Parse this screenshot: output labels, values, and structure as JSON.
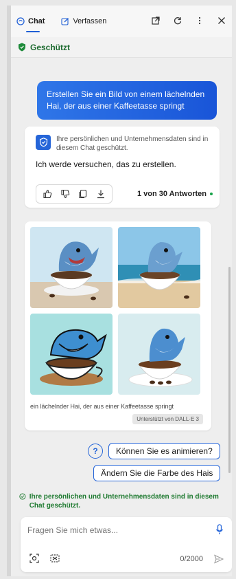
{
  "header": {
    "tabs": [
      {
        "label": "Chat",
        "active": true
      },
      {
        "label": "Verfassen",
        "active": false
      }
    ],
    "actions": [
      "open-external-icon",
      "refresh-icon",
      "more-icon",
      "close-icon"
    ]
  },
  "protected_banner": {
    "label": "Geschützt"
  },
  "conversation": {
    "user_message": "Erstellen Sie ein Bild von einem lächelnden Hai, der aus einer Kaffeetasse springt",
    "bot": {
      "notice": "Ihre persönlichen und Unternehmensdaten sind in diesem Chat geschützt.",
      "reply": "Ich werde versuchen, das zu erstellen.",
      "answer_count": "1 von 30 Antworten"
    },
    "image_result": {
      "caption": "ein lächelnder Hai, der aus einer Kaffeetasse springt",
      "badge": "Unterstützt von DALL·E 3"
    }
  },
  "suggestions": [
    {
      "label": "Können Sie es animieren?"
    },
    {
      "label": "Ändern Sie die Farbe des Hais"
    }
  ],
  "privacy_footer": "Ihre persönlichen und Unternehmensdaten sind in diesem Chat geschützt.",
  "composer": {
    "placeholder": "Fragen Sie mich etwas...",
    "counter": "0/2000"
  },
  "colors": {
    "accent": "#2565d8",
    "protected_green": "#1e7a30",
    "user_bubble": "#1f5fd6"
  }
}
